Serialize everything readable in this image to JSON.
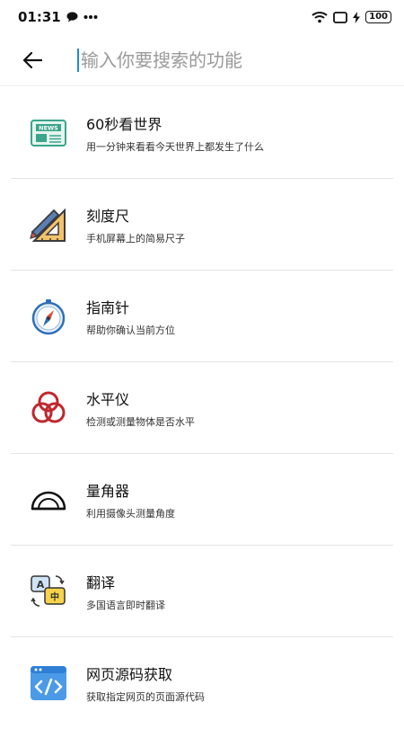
{
  "status": {
    "time": "01:31",
    "battery": "100"
  },
  "search": {
    "placeholder": "输入你要搜索的功能",
    "value": ""
  },
  "items": [
    {
      "title": "60秒看世界",
      "subtitle": "用一分钟来看看今天世界上都发生了什么",
      "icon": "newspaper-icon"
    },
    {
      "title": "刻度尺",
      "subtitle": "手机屏幕上的简易尺子",
      "icon": "ruler-icon"
    },
    {
      "title": "指南针",
      "subtitle": "帮助你确认当前方位",
      "icon": "compass-icon"
    },
    {
      "title": "水平仪",
      "subtitle": "检测或测量物体是否水平",
      "icon": "level-icon"
    },
    {
      "title": "量角器",
      "subtitle": "利用摄像头测量角度",
      "icon": "protractor-icon"
    },
    {
      "title": "翻译",
      "subtitle": "多国语言即时翻译",
      "icon": "translate-icon"
    },
    {
      "title": "网页源码获取",
      "subtitle": "获取指定网页的页面源代码",
      "icon": "code-icon"
    }
  ],
  "icon_labels": {
    "newspaper": "NEWS",
    "translate_a": "A",
    "translate_b": "中"
  }
}
